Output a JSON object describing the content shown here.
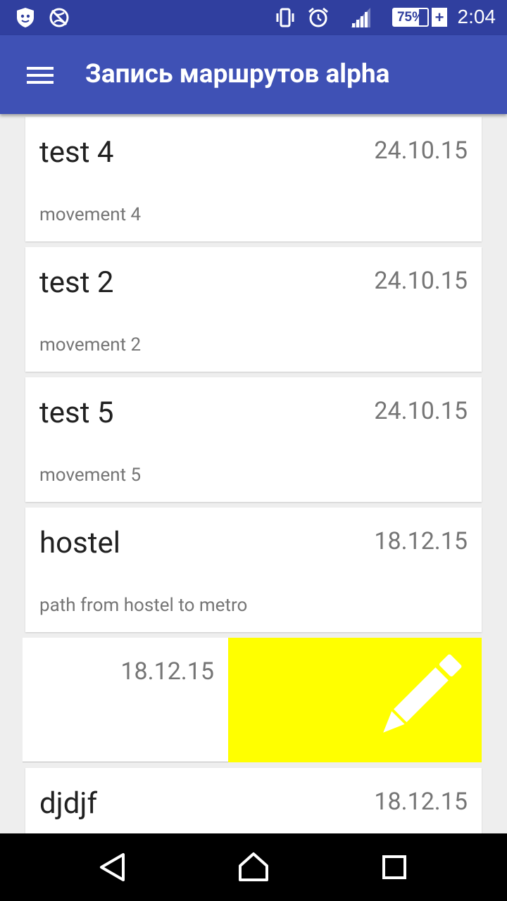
{
  "status_bar": {
    "time": "2:04",
    "battery_percent": 75,
    "battery_label": "75%",
    "charging": true,
    "icons": [
      "shield-app-icon",
      "no-sync-icon",
      "vibrate-icon",
      "alarm-icon",
      "signal-icon",
      "battery-icon"
    ]
  },
  "app_bar": {
    "title": "Запись маршрутов alpha",
    "menu_icon": "hamburger-menu-icon",
    "color": "#3F51B5",
    "status_color": "#303F9F"
  },
  "routes": [
    {
      "title": "test 4",
      "date": "24.10.15",
      "description": "movement 4"
    },
    {
      "title": "test 2",
      "date": "24.10.15",
      "description": "movement 2"
    },
    {
      "title": "test 5",
      "date": "24.10.15",
      "description": "movement 5"
    },
    {
      "title": "hostel",
      "date": "18.12.15",
      "description": "path from hostel to metro"
    }
  ],
  "swiped_item": {
    "date": "18.12.15",
    "action_icon": "pencil-edit-icon",
    "action_color": "#FFFF00"
  },
  "partial_item": {
    "title": "djdjf",
    "date": "18.12.15"
  },
  "nav_bar": {
    "icons": [
      "back-icon",
      "home-icon",
      "recents-icon"
    ]
  }
}
